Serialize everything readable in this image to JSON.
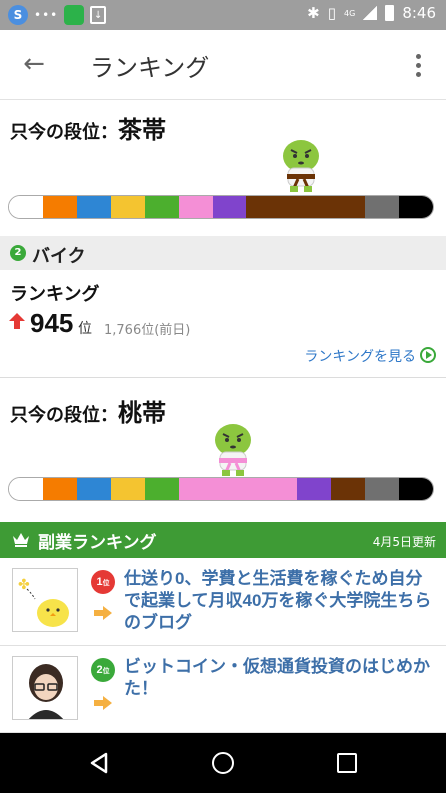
{
  "status_bar": {
    "time": "8:46",
    "network": "4G",
    "icons": [
      "browser-app-icon",
      "more-dots-icon",
      "line-app-icon",
      "download-icon",
      "bluetooth-icon",
      "vibrate-icon",
      "signal-icon",
      "battery-icon"
    ],
    "line_label": "LINE"
  },
  "app_bar": {
    "title": "ランキング",
    "back_icon": "back-arrow-icon",
    "menu_icon": "overflow-menu-icon"
  },
  "rank_top": {
    "prefix": "只今の段位：",
    "belt": "茶帯",
    "belt_colors": [
      "#ffffff",
      "#f57c00",
      "#2e86d4",
      "#f4c430",
      "#4caf2e",
      "#f48fd6",
      "#8044cc",
      "#6b3306",
      "#707070",
      "#000000"
    ],
    "active_index": 7
  },
  "category": {
    "number": "2",
    "name": "バイク"
  },
  "ranking": {
    "label": "ランキング",
    "rank": "945",
    "unit": "位",
    "previous": "1,766位(前日)",
    "link": "ランキングを見る"
  },
  "rank_bottom": {
    "prefix": "只今の段位：",
    "belt": "桃帯",
    "active_index": 5
  },
  "side_ranking": {
    "title": "副業ランキング",
    "date": "4月5日更新",
    "entries": [
      {
        "rank": "1",
        "rank_unit": "位",
        "title": "仕送り0、学費と生活費を稼ぐため自分で起業して月収40万を稼ぐ大学院生ちらのブログ",
        "medal_color": "#e53935"
      },
      {
        "rank": "2",
        "rank_unit": "位",
        "title": "ビットコイン・仮想通貨投資のはじめかた！",
        "medal_color": "#3aa93a"
      }
    ]
  },
  "nav_bar": {
    "icons": [
      "nav-back-icon",
      "nav-home-icon",
      "nav-recents-icon"
    ]
  }
}
